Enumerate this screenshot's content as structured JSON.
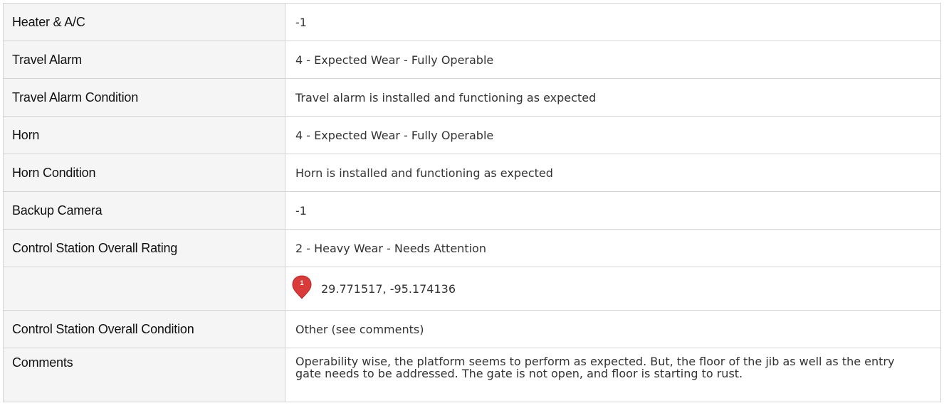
{
  "rows": [
    {
      "label": "Heater & A/C",
      "value": "-1"
    },
    {
      "label": "Travel Alarm",
      "value": "4 - Expected Wear - Fully Operable"
    },
    {
      "label": "Travel Alarm Condition",
      "value": "Travel alarm is installed and functioning as expected"
    },
    {
      "label": "Horn",
      "value": "4 - Expected Wear - Fully Operable"
    },
    {
      "label": "Horn Condition",
      "value": "Horn is installed and functioning as expected"
    },
    {
      "label": "Backup Camera",
      "value": "-1"
    },
    {
      "label": "Control Station Overall Rating",
      "value": "2 - Heavy Wear - Needs Attention"
    }
  ],
  "location": {
    "label": "",
    "marker_number": "1",
    "marker_icon": "map-pin-icon",
    "marker_color": "#d93a3a",
    "coordinates": "29.771517, -95.174136"
  },
  "condition": {
    "label": "Control Station Overall Condition",
    "value": "Other (see comments)"
  },
  "comments": {
    "label": "Comments",
    "value": "Operability wise, the platform seems to perform as expected. But, the floor of the jib as well as the entry gate needs to be addressed. The gate is not open, and floor is starting to rust."
  }
}
